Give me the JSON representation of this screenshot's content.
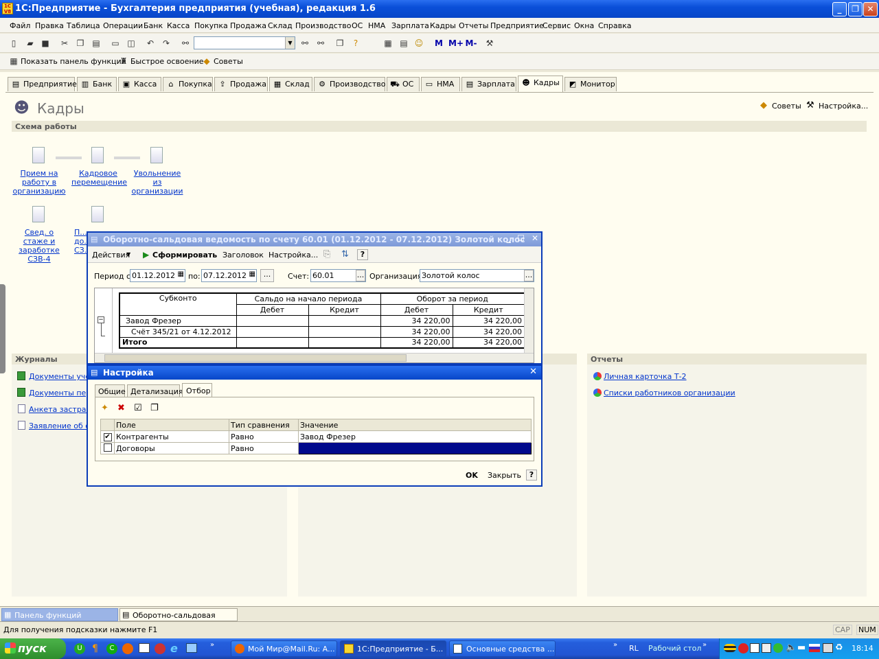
{
  "window": {
    "title": "1С:Предприятие - Бухгалтерия предприятия (учебная), редакция 1.6",
    "logo": "1С V8"
  },
  "menu": [
    "Файл",
    "Правка",
    "Таблица",
    "Операции",
    "Банк",
    "Касса",
    "Покупка",
    "Продажа",
    "Склад",
    "Производство",
    "ОС",
    "НМА",
    "Зарплата",
    "Кадры",
    "Отчеты",
    "Предприятие",
    "Сервис",
    "Окна",
    "Справка"
  ],
  "toolbar2": {
    "show_panel": "Показать панель функций",
    "quick": "Быстрое освоение",
    "tips": "Советы"
  },
  "tabs": [
    "Предприятие",
    "Банк",
    "Касса",
    "Покупка",
    "Продажа",
    "Склад",
    "Производство",
    "ОС",
    "НМА",
    "Зарплата",
    "Кадры",
    "Монитор"
  ],
  "page": {
    "title": "Кадры",
    "tips": "Советы",
    "settings": "Настройка...",
    "scheme": "Схема работы"
  },
  "scheme": [
    {
      "label": "Прием на работу в организацию"
    },
    {
      "label": "Кадровое перемещение"
    },
    {
      "label": "Увольнение из организации"
    },
    {
      "label": "Свед. о стаже и заработке СЗВ-4"
    },
    {
      "label": "П... до... СЗ..."
    }
  ],
  "journals": {
    "title": "Журналы",
    "items": [
      "Документы учет",
      "Документы перс",
      "Анкета застрах",
      "Заявление об об"
    ]
  },
  "reports": {
    "title": "Отчеты",
    "items": [
      "Личная карточка Т-2",
      "Списки работников организации"
    ]
  },
  "osv": {
    "title": "Оборотно-сальдовая ведомость по счету 60.01 (01.12.2012 - 07.12.2012) Золотой колос",
    "actions": "Действия",
    "form": "Сформировать",
    "header": "Заголовок",
    "settings": "Настройка...",
    "help": "?",
    "period_label": "Период с:",
    "period_from": "01.12.2012",
    "to_label": "по:",
    "period_to": "07.12.2012",
    "account_label": "Счет:",
    "account": "60.01",
    "org_label": "Организация:",
    "org": "Золотой колос",
    "cols": {
      "subkonto": "Субконто",
      "opening": "Сальдо на начало периода",
      "turnover": "Оборот за период",
      "debit": "Дебет",
      "credit": "Кредит"
    },
    "rows": [
      {
        "name": "Завод Фрезер",
        "od": "",
        "oc": "",
        "td": "34 220,00",
        "tc": "34 220,00"
      },
      {
        "name": "Счёт 345/21 от 4.12.2012",
        "od": "",
        "oc": "",
        "td": "34 220,00",
        "tc": "34 220,00"
      },
      {
        "name": "Итого",
        "od": "",
        "oc": "",
        "td": "34 220,00",
        "tc": "34 220,00"
      }
    ]
  },
  "settings": {
    "title": "Настройка",
    "tabs": [
      "Общие",
      "Детализация",
      "Отбор"
    ],
    "cols": [
      "Поле",
      "Тип сравнения",
      "Значение"
    ],
    "rows": [
      {
        "checked": true,
        "field": "Контрагенты",
        "cmp": "Равно",
        "value": "Завод Фрезер"
      },
      {
        "checked": false,
        "field": "Договоры",
        "cmp": "Равно",
        "value": ""
      }
    ],
    "ok": "OK",
    "close": "Закрыть",
    "help": "?"
  },
  "bottom_tabs": [
    "Панель функций",
    "Оборотно-сальдовая ведом..."
  ],
  "status": {
    "hint": "Для получения подсказки нажмите F1",
    "cap": "CAP",
    "num": "NUM"
  },
  "taskbar": {
    "start": "пуск",
    "tasks": [
      "Мой Мир@Mail.Ru: А...",
      "1С:Предприятие - Б...",
      "Основные средства ..."
    ],
    "lang": "RL",
    "desktop": "Рабочий стол",
    "time": "18:14"
  },
  "colors": {
    "title_blue": "#0a4fd8",
    "link": "#0033cc",
    "selection": "#000a8c"
  }
}
